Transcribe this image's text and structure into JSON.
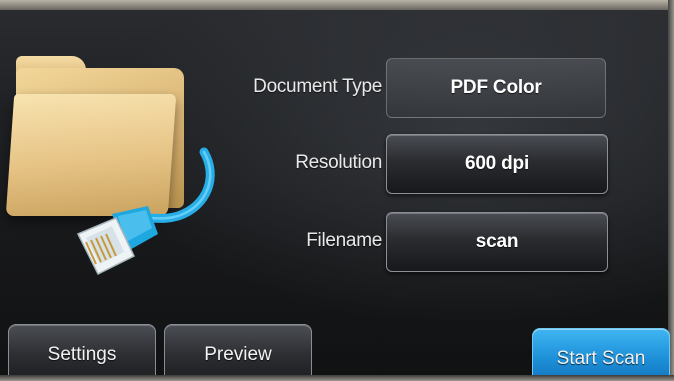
{
  "form": {
    "document_type": {
      "label": "Document Type",
      "value": "PDF Color"
    },
    "resolution": {
      "label": "Resolution",
      "value": "600 dpi"
    },
    "filename": {
      "label": "Filename",
      "value": "scan"
    }
  },
  "footer": {
    "settings_label": "Settings",
    "preview_label": "Preview",
    "start_scan_label": "Start Scan"
  },
  "icons": {
    "illustration": "folder-network-cable-icon"
  },
  "colors": {
    "primary_button": "#1d8fd8",
    "cable": "#29b6e8",
    "folder": "#e6c385"
  }
}
